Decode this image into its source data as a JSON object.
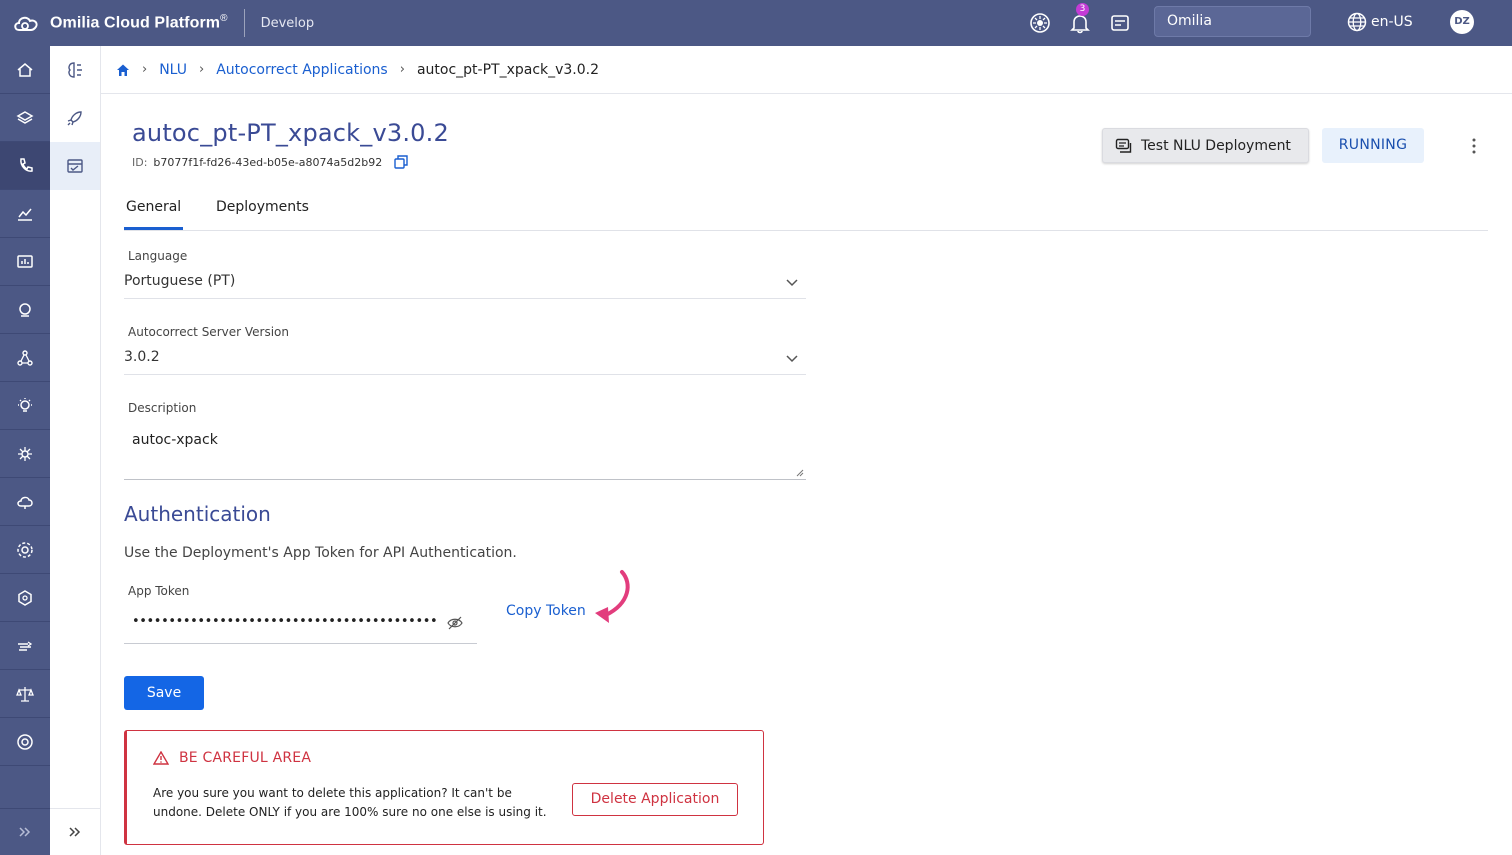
{
  "topbar": {
    "brand": "Omilia Cloud Platform",
    "brand_mark": "®",
    "section": "Develop",
    "notification_count": "3",
    "organization": "Omilia",
    "language": "en-US",
    "user_initials": "DZ"
  },
  "rail": {
    "items": [
      "home-icon",
      "layers-icon",
      "phone-icon",
      "analytics-icon",
      "reports-icon",
      "support-icon",
      "network-icon",
      "ideas-icon",
      "brain-icon",
      "cloud-icon",
      "settings-icon",
      "package-icon",
      "speed-icon",
      "balance-icon",
      "help-icon"
    ],
    "active_index": 2,
    "expand_icon": "double-chevron-right-icon"
  },
  "subrail": {
    "items": [
      "nlu-icon",
      "rocket-icon",
      "autocorrect-icon"
    ],
    "active_index": 2,
    "expand_icon": "double-chevron-right-icon"
  },
  "breadcrumb": {
    "items": [
      "NLU",
      "Autocorrect Applications"
    ],
    "current": "autoc_pt-PT_xpack_v3.0.2"
  },
  "header": {
    "title": "autoc_pt-PT_xpack_v3.0.2",
    "id_label": "ID:",
    "id_value": "b7077f1f-fd26-43ed-b05e-a8074a5d2b92",
    "test_button": "Test NLU Deployment",
    "status": "RUNNING"
  },
  "tabs": [
    {
      "label": "General",
      "active": true
    },
    {
      "label": "Deployments",
      "active": false
    }
  ],
  "form": {
    "language_label": "Language",
    "language_value": "Portuguese (PT)",
    "version_label": "Autocorrect Server Version",
    "version_value": "3.0.2",
    "description_label": "Description",
    "description_value": "autoc-xpack"
  },
  "auth": {
    "title": "Authentication",
    "description": "Use the Deployment's App Token for API Authentication.",
    "token_label": "App Token",
    "token_value": "••••••••••••••••••••••••••••••••••••••••••",
    "copy_token": "Copy Token"
  },
  "save_label": "Save",
  "careful": {
    "title": "BE CAREFUL AREA",
    "text": "Are you sure you want to delete this application? It can't be undone. Delete ONLY if you are 100% sure no one else is using it.",
    "delete_label": "Delete Application"
  },
  "colors": {
    "topbar": "#4c5885",
    "accent": "#1466e5",
    "title": "#3a4a95",
    "danger": "#cf3341",
    "highlight_arrow": "#e23d7d"
  }
}
